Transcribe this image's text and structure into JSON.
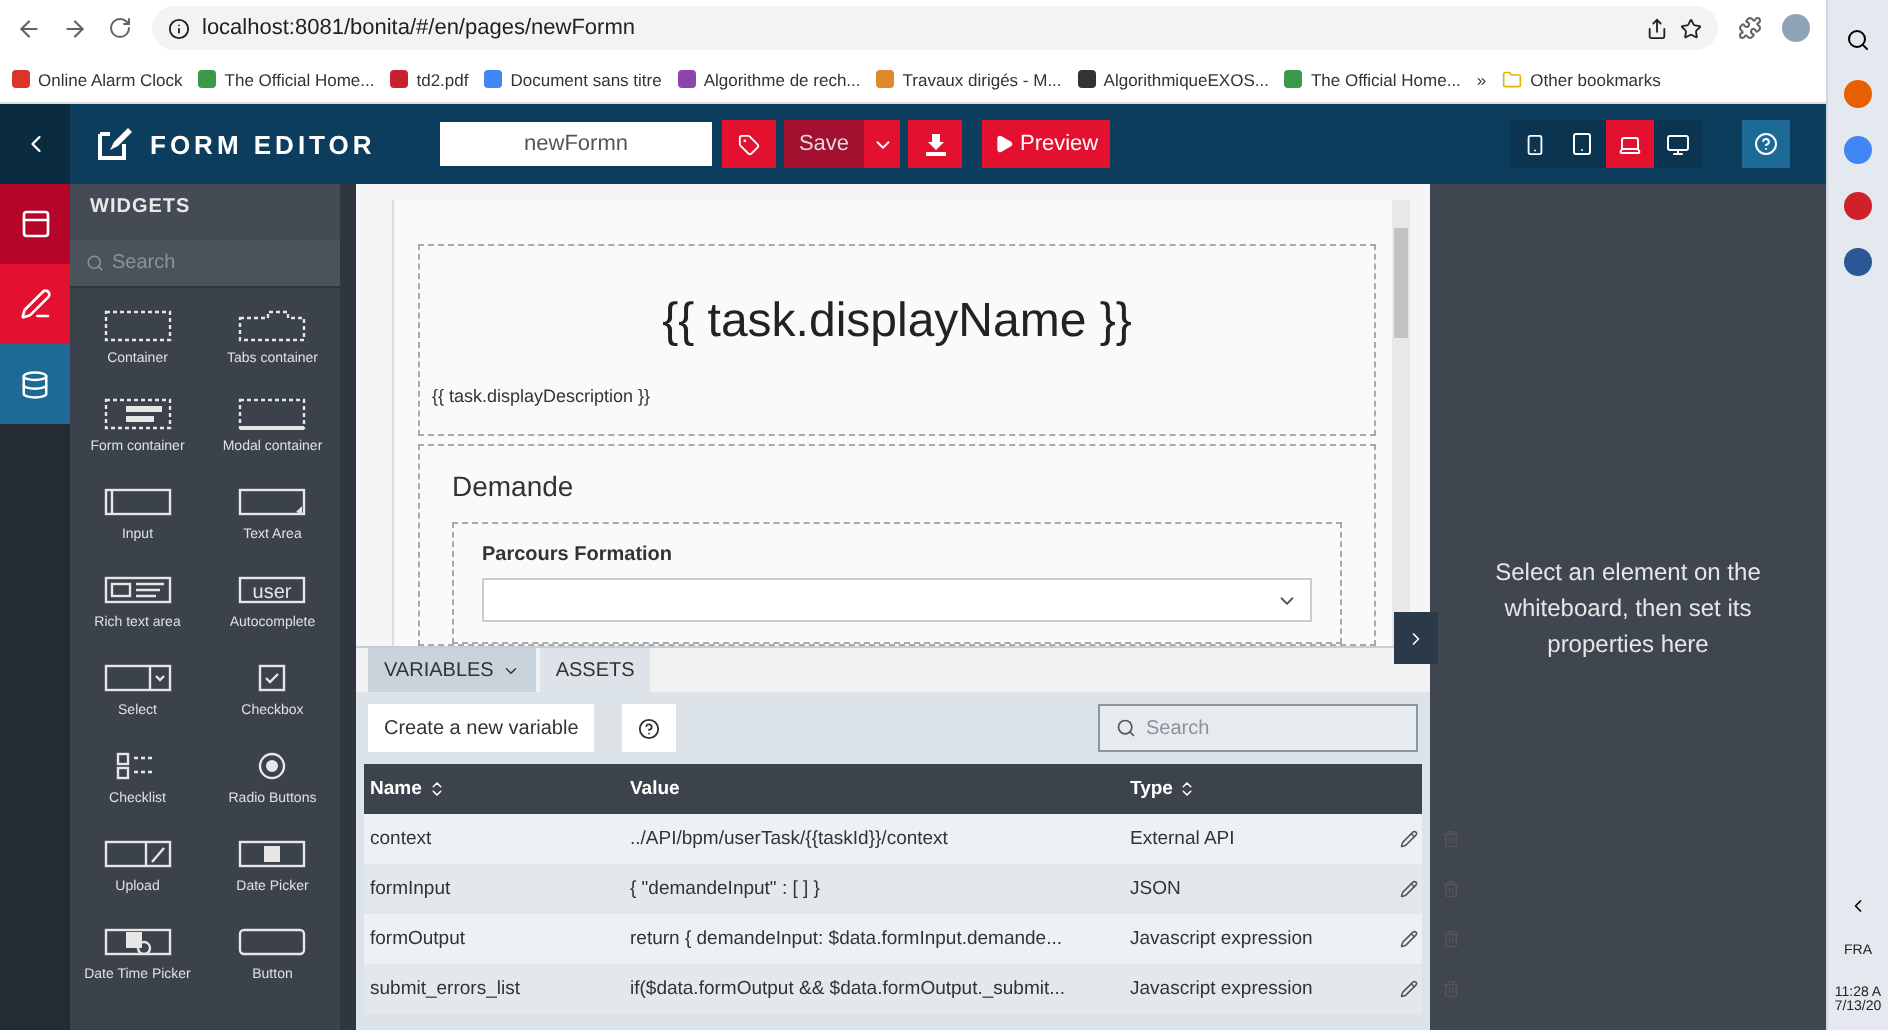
{
  "browser": {
    "url": "localhost:8081/bonita/#/en/pages/newFormn",
    "bookmarks": [
      {
        "label": "Online Alarm Clock",
        "color": "#d9352b"
      },
      {
        "label": "The Official Home...",
        "color": "#3a9a4a"
      },
      {
        "label": "td2.pdf",
        "color": "#c8202c"
      },
      {
        "label": "Document sans titre",
        "color": "#4285f4"
      },
      {
        "label": "Algorithme de rech...",
        "color": "#8e44ad"
      },
      {
        "label": "Travaux dirigés - M...",
        "color": "#e0892b"
      },
      {
        "label": "AlgorithmiqueEXOS...",
        "color": "#333333"
      },
      {
        "label": "The Official Home...",
        "color": "#3a9a4a"
      }
    ],
    "overflow": "»",
    "other_bookmarks": "Other bookmarks"
  },
  "header": {
    "title": "FORM EDITOR",
    "form_name": "newFormn",
    "save": "Save",
    "preview": "Preview",
    "devices": [
      {
        "kind": "phone",
        "selected": false
      },
      {
        "kind": "tablet",
        "selected": false
      },
      {
        "kind": "laptop",
        "selected": true
      },
      {
        "kind": "desktop",
        "selected": false
      }
    ]
  },
  "sidebar": {
    "items": [
      {
        "kind": "layout",
        "color": "#b5062a"
      },
      {
        "kind": "pen",
        "color": "#e3102f"
      },
      {
        "kind": "data",
        "color": "#1e6a96"
      }
    ]
  },
  "widgets": {
    "title": "WIDGETS",
    "search_placeholder": "Search",
    "autocomplete_icon_text": "user",
    "items": [
      {
        "label": "Container",
        "kind": "container"
      },
      {
        "label": "Tabs container",
        "kind": "tabs"
      },
      {
        "label": "Form container",
        "kind": "form"
      },
      {
        "label": "Modal container",
        "kind": "modal"
      },
      {
        "label": "Input",
        "kind": "input"
      },
      {
        "label": "Text Area",
        "kind": "textarea"
      },
      {
        "label": "Rich text area",
        "kind": "richtext"
      },
      {
        "label": "Autocomplete",
        "kind": "autocomplete"
      },
      {
        "label": "Select",
        "kind": "select"
      },
      {
        "label": "Checkbox",
        "kind": "checkbox"
      },
      {
        "label": "Checklist",
        "kind": "checklist"
      },
      {
        "label": "Radio Buttons",
        "kind": "radio"
      },
      {
        "label": "Upload",
        "kind": "upload"
      },
      {
        "label": "Date Picker",
        "kind": "date"
      },
      {
        "label": "Date Time Picker",
        "kind": "datetime"
      },
      {
        "label": "Button",
        "kind": "button"
      }
    ]
  },
  "canvas": {
    "title": "{{ task.displayName }}",
    "description": "{{ task.displayDescription }}",
    "section": "Demande",
    "field_label": "Parcours Formation"
  },
  "variables": {
    "tabs": [
      {
        "label": "VARIABLES",
        "selected": true
      },
      {
        "label": "ASSETS",
        "selected": false
      }
    ],
    "create_button": "Create a new variable",
    "search_placeholder": "Search",
    "columns": [
      {
        "label": "Name",
        "sortable": true
      },
      {
        "label": "Value",
        "sortable": false
      },
      {
        "label": "Type",
        "sortable": true
      }
    ],
    "rows": [
      {
        "name": "context",
        "value": "../API/bpm/userTask/{{taskId}}/context",
        "type": "External API"
      },
      {
        "name": "formInput",
        "value": "{ \"demandeInput\" : [ ] }",
        "type": "JSON"
      },
      {
        "name": "formOutput",
        "value": "return { demandeInput: $data.formInput.demande...",
        "type": "Javascript expression"
      },
      {
        "name": "submit_errors_list",
        "value": "if($data.formOutput && $data.formOutput._submit...",
        "type": "Javascript expression"
      }
    ]
  },
  "properties": {
    "hint": "Select an element on the whiteboard, then set its properties here"
  },
  "taskbar": {
    "language": "FRA",
    "time": "11:28 A",
    "date": "7/13/20"
  }
}
